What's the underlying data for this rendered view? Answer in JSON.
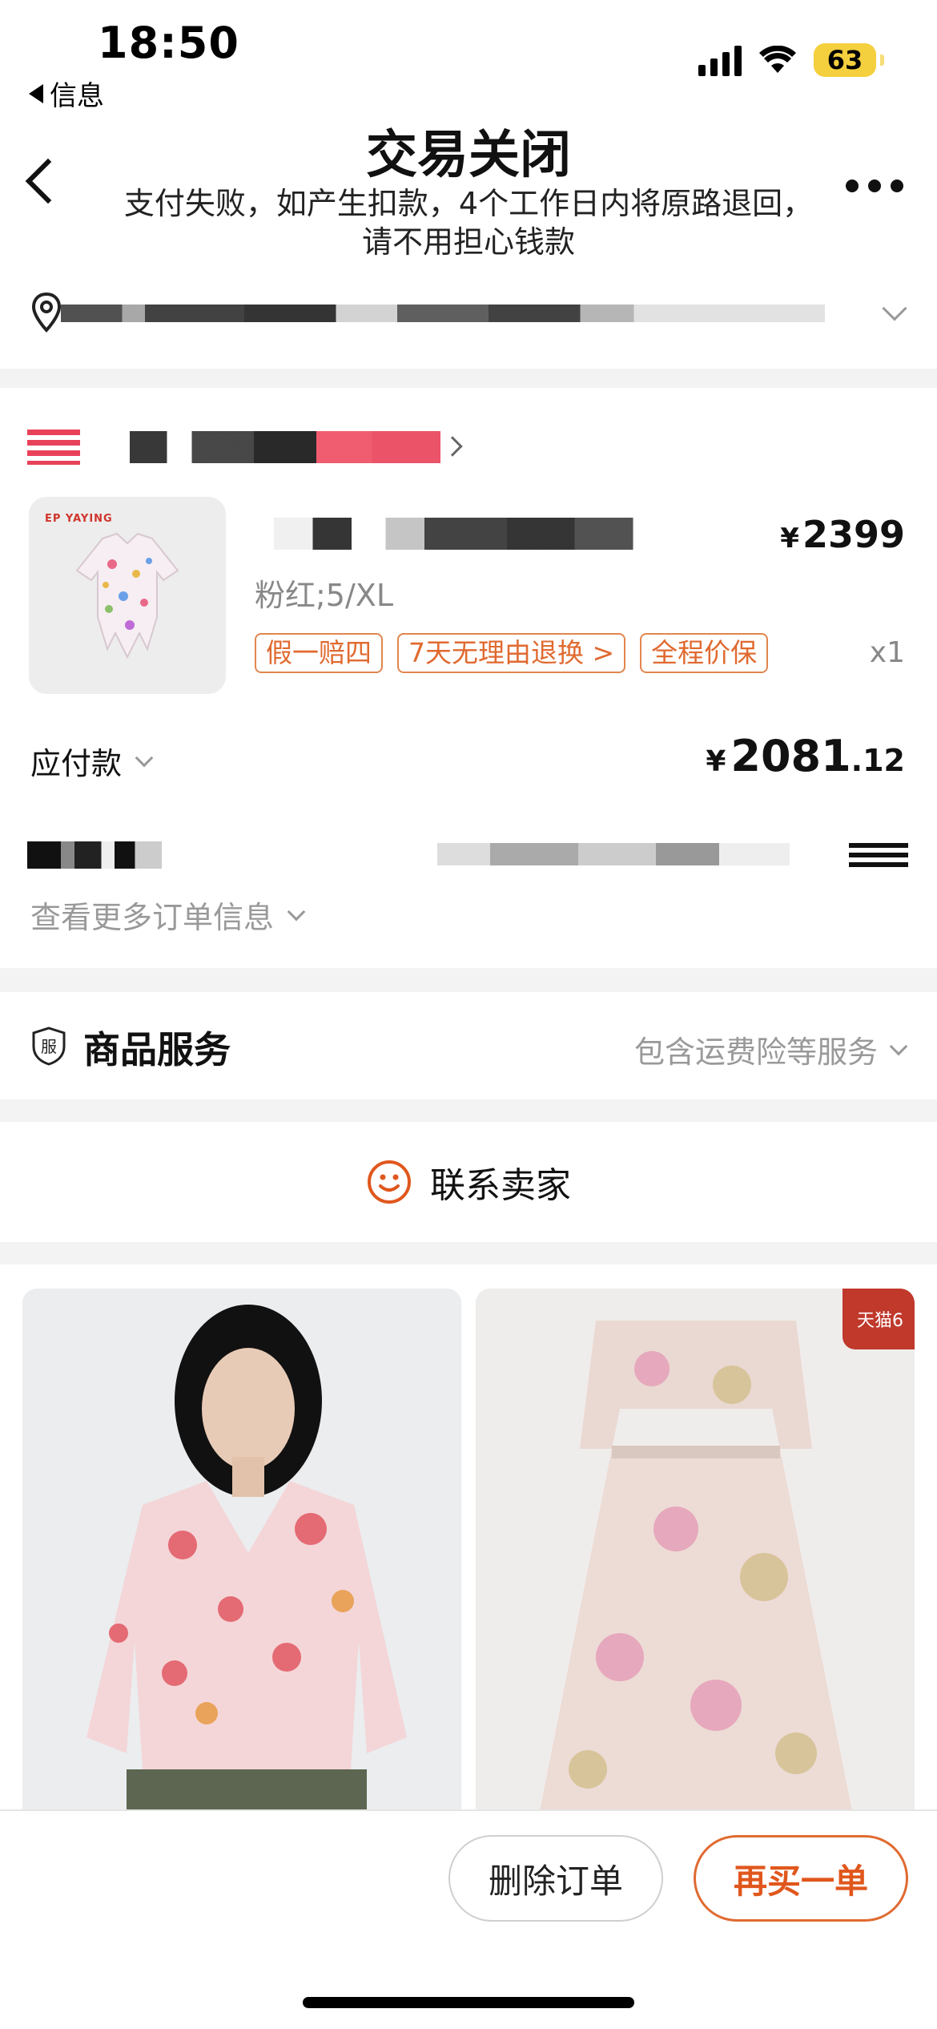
{
  "status_bar": {
    "time": "18:50",
    "back_app": "信息",
    "battery": "63",
    "icons": [
      "signal-icon",
      "wifi-icon",
      "battery-icon"
    ]
  },
  "header": {
    "title": "交易关闭",
    "subtitle": "支付失败，如产生扣款，4个工作日内将原路退回，请不用担心钱款"
  },
  "product": {
    "brand_on_image": "EP YAYING",
    "price_symbol": "¥",
    "price": "2399",
    "sku": "粉红;5/XL",
    "tags": [
      "假一赔四",
      "7天无理由退换 >",
      "全程价保"
    ],
    "quantity": "x1"
  },
  "payment": {
    "label": "应付款",
    "symbol": "¥",
    "amount_int": "2081",
    "amount_dec": ".12"
  },
  "order_info": {
    "more_label": "查看更多订单信息"
  },
  "service": {
    "icon_char": "服",
    "title": "商品服务",
    "summary": "包含运费险等服务"
  },
  "contact": {
    "label": "联系卖家"
  },
  "recommend": {
    "badge": "天猫6"
  },
  "actions": {
    "delete": "删除订单",
    "rebuy": "再买一单"
  },
  "colors": {
    "accent": "#e0571d",
    "tag_border": "#e0864e",
    "muted": "#999999"
  }
}
